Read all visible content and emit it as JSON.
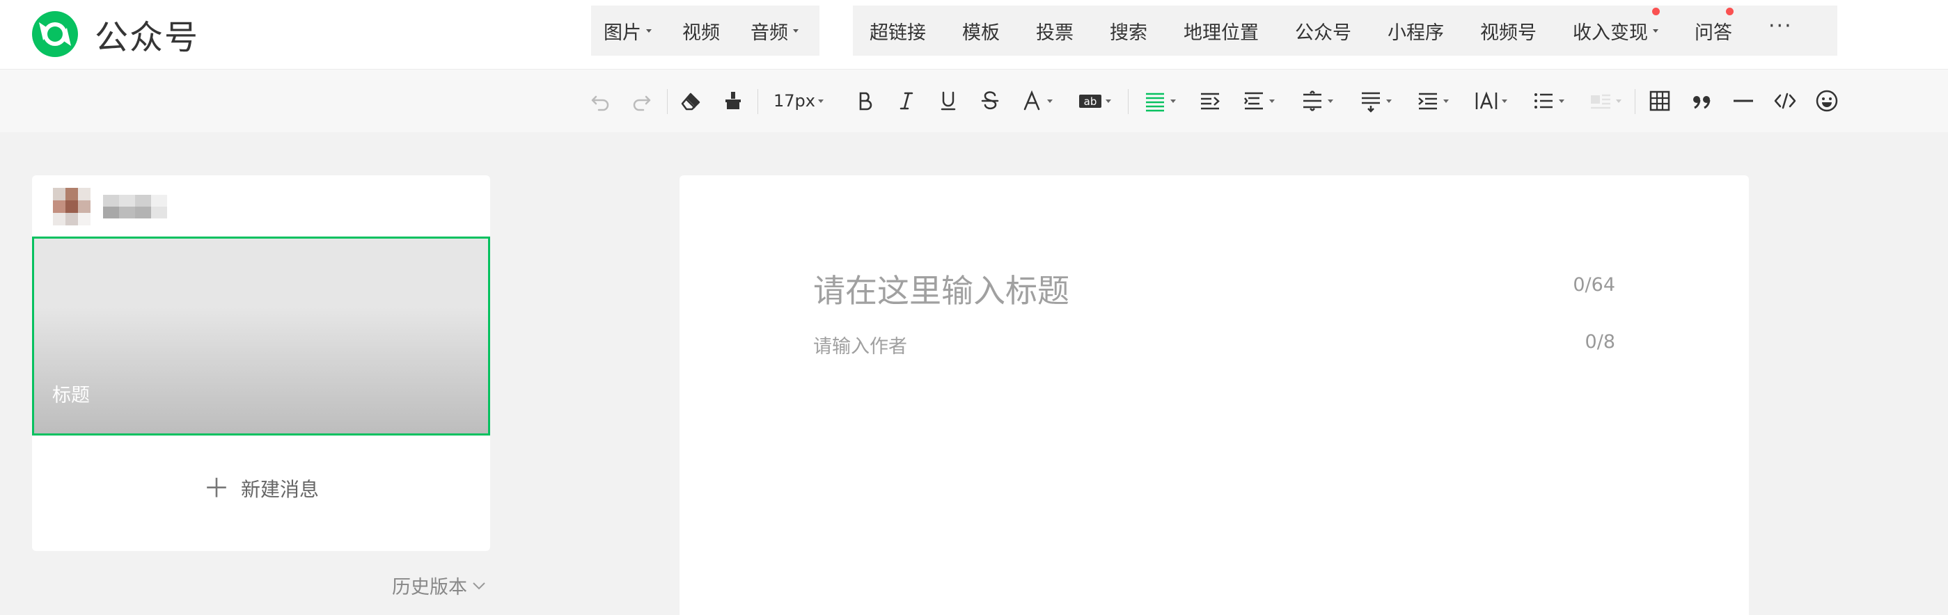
{
  "header": {
    "logo_text": "公众号",
    "media_group_1": [
      {
        "label": "图片",
        "dropdown": true
      },
      {
        "label": "视频",
        "dropdown": false
      },
      {
        "label": "音频",
        "dropdown": true
      }
    ],
    "media_group_2": [
      {
        "label": "超链接",
        "dropdown": false
      },
      {
        "label": "模板",
        "dropdown": false
      },
      {
        "label": "投票",
        "dropdown": false
      },
      {
        "label": "搜索",
        "dropdown": false
      },
      {
        "label": "地理位置",
        "dropdown": false
      },
      {
        "label": "公众号",
        "dropdown": false
      },
      {
        "label": "小程序",
        "dropdown": false
      },
      {
        "label": "视频号",
        "dropdown": false
      },
      {
        "label": "收入变现",
        "dropdown": true,
        "badge": true
      },
      {
        "label": "问答",
        "dropdown": false,
        "badge": true
      }
    ],
    "more_label": "···"
  },
  "toolbar": {
    "font_size": "17px",
    "accent_color": "#07c160"
  },
  "left_panel": {
    "cover_title": "标题",
    "new_message_label": "新建消息",
    "history_label": "历史版本"
  },
  "editor": {
    "title_placeholder": "请在这里输入标题",
    "title_count": "0/64",
    "author_placeholder": "请输入作者",
    "author_count": "0/8"
  },
  "colors": {
    "brand": "#07c160",
    "badge": "#fa5151"
  }
}
